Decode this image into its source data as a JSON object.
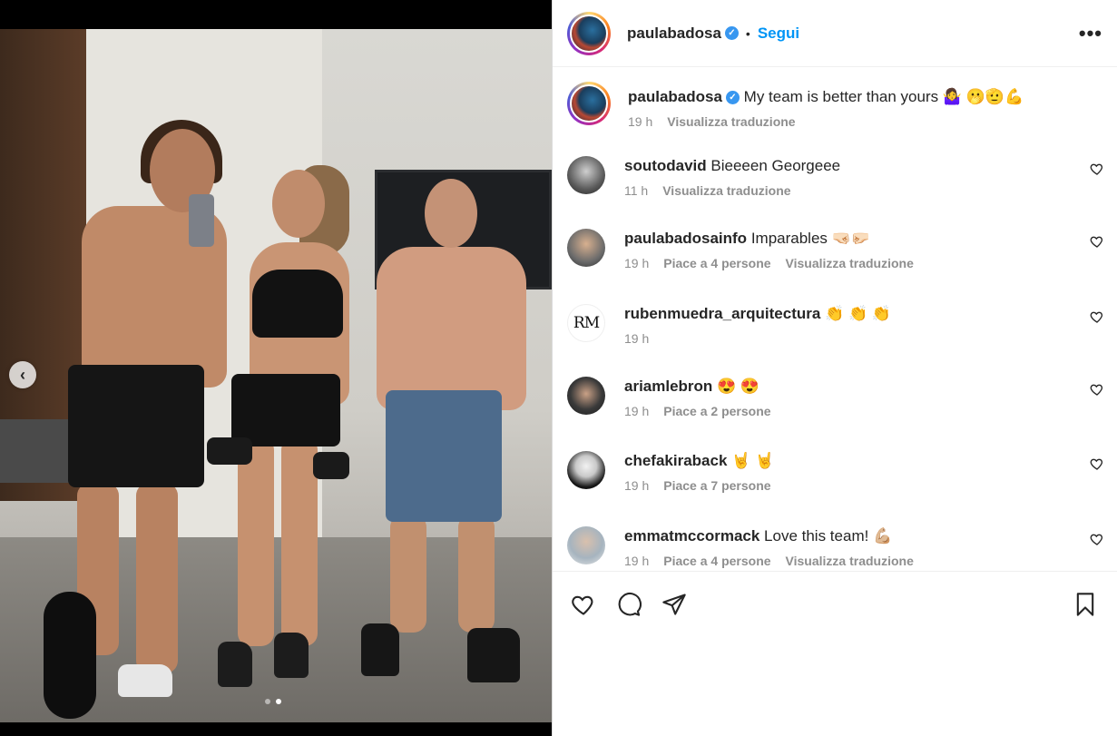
{
  "post": {
    "author": "paulabadosa",
    "follow_label": "Segui",
    "separator": "•",
    "more_label": "•••",
    "caption": {
      "user": "paulabadosa",
      "text": "My team is better than yours 🤷‍♀️ 🫢🫡💪",
      "time": "19 h",
      "translate": "Visualizza traduzione"
    }
  },
  "media": {
    "prev_label": "‹",
    "slide_index": 2,
    "slide_count": 2
  },
  "comments": [
    {
      "user": "soutodavid",
      "text": "Bieeeen Georgeee",
      "time": "11 h",
      "likes": "",
      "translate": "Visualizza traduzione"
    },
    {
      "user": "paulabadosainfo",
      "text": "Imparables 🤜🏻🤛🏻",
      "time": "19 h",
      "likes": "Piace a 4 persone",
      "translate": "Visualizza traduzione"
    },
    {
      "user": "rubenmuedra_arquitectura",
      "text": "👏 👏 👏",
      "time": "19 h",
      "likes": "",
      "translate": "",
      "avatar_text": "RM"
    },
    {
      "user": "ariamlebron",
      "text": "😍 😍",
      "time": "19 h",
      "likes": "Piace a 2 persone",
      "translate": ""
    },
    {
      "user": "chefakiraback",
      "text": "🤘 🤘",
      "time": "19 h",
      "likes": "Piace a 7 persone",
      "translate": ""
    },
    {
      "user": "emmatmccormack",
      "text": "Love this team! 💪🏼",
      "time": "19 h",
      "likes": "Piace a 4 persone",
      "translate": "Visualizza traduzione"
    }
  ],
  "icons": {
    "like": "heart-icon",
    "comment": "comment-icon",
    "share": "paper-plane-icon",
    "save": "bookmark-icon",
    "verified": "verified-badge-icon"
  },
  "colors": {
    "accent": "#0095f6",
    "verified": "#3897f0",
    "text": "#262626",
    "secondary": "#8e8e8e"
  }
}
